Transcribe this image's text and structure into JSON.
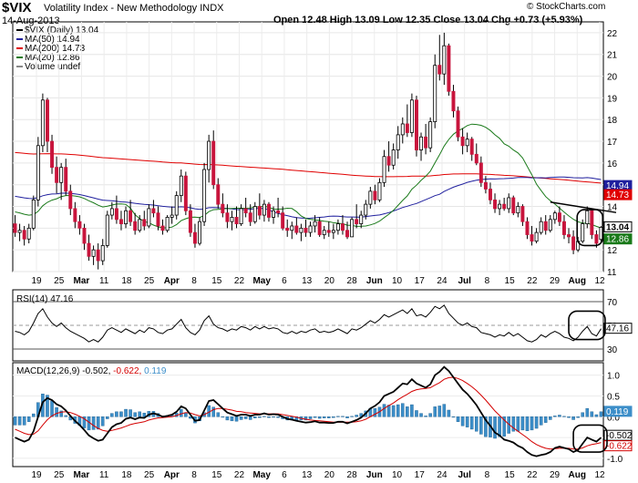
{
  "header": {
    "symbol": "$VIX",
    "name": "Volatility Index - New Methodology",
    "exchange": "INDX",
    "date": "14-Aug-2013",
    "ohlc_text": "Open 12.48  High 13.09  Low 12.35  Close 13.04  Chg +0.73 (+5.93%)",
    "open": "12.48",
    "high": "13.09",
    "low": "12.35",
    "close": "13.04",
    "change": "+0.73 (+5.93%)",
    "brand": "© StockCharts.com"
  },
  "legend": [
    {
      "label": "$VIX (Daily) 13.04",
      "color": "#000000"
    },
    {
      "label": "MA(50) 14.94",
      "color": "#1f1f9e"
    },
    {
      "label": "MA(200) 14.73",
      "color": "#e00000"
    },
    {
      "label": "MA(20) 12.86",
      "color": "#1a7a1a"
    },
    {
      "label": "Volume undef",
      "color": "#888888"
    }
  ],
  "rsi_label": "RSI(14) 47.16",
  "macd_label": {
    "prefix": "MACD(12,26,9)",
    "macd": "-0.502,",
    "signal": "-0.622,",
    "hist": "0.119",
    "macd_color": "#000000",
    "signal_color": "#d40000",
    "hist_color": "#3c8ec9"
  },
  "colors": {
    "up": "#ffffff",
    "down": "#c8143c",
    "ma50": "#1f1f9e",
    "ma200": "#e00000",
    "ma20": "#1a7a1a",
    "annotation": "#000000"
  },
  "chart_data": {
    "type": "candlestick",
    "price": {
      "ylim": [
        11,
        22.5
      ],
      "yticks": [
        11,
        12,
        13,
        14,
        15,
        16,
        17,
        18,
        19,
        20,
        21,
        22
      ],
      "right_labels": [
        "14.94",
        "14.73",
        "13.04",
        "12.86"
      ],
      "x_ticks": [
        "19",
        "25",
        "Mar",
        "11",
        "18",
        "25",
        "Apr",
        "8",
        "15",
        "22",
        "May",
        "6",
        "13",
        "20",
        "28",
        "Jun",
        "10",
        "17",
        "24",
        "Jul",
        "8",
        "15",
        "22",
        "29",
        "Aug",
        "12"
      ],
      "ohlc": [
        [
          13.2,
          13.6,
          12.6,
          12.8
        ],
        [
          12.8,
          13.2,
          12.4,
          12.9
        ],
        [
          12.9,
          13.1,
          12.2,
          12.5
        ],
        [
          12.5,
          13.2,
          12.3,
          13.0
        ],
        [
          13.0,
          14.5,
          12.9,
          14.3
        ],
        [
          14.3,
          17.2,
          14.0,
          16.8
        ],
        [
          16.8,
          19.2,
          16.5,
          18.9
        ],
        [
          18.9,
          19.0,
          16.5,
          17.0
        ],
        [
          17.0,
          17.3,
          15.5,
          15.8
        ],
        [
          15.8,
          16.3,
          14.6,
          15.1
        ],
        [
          15.1,
          16.0,
          14.3,
          15.8
        ],
        [
          15.8,
          16.2,
          14.5,
          14.7
        ],
        [
          14.7,
          15.0,
          13.6,
          13.9
        ],
        [
          13.9,
          14.2,
          13.0,
          13.3
        ],
        [
          13.3,
          13.6,
          12.7,
          13.0
        ],
        [
          13.0,
          13.2,
          12.0,
          12.3
        ],
        [
          12.3,
          12.7,
          11.5,
          11.7
        ],
        [
          11.7,
          12.2,
          11.3,
          12.0
        ],
        [
          12.0,
          12.3,
          11.1,
          11.5
        ],
        [
          11.5,
          12.5,
          11.3,
          12.2
        ],
        [
          12.2,
          13.8,
          12.1,
          13.6
        ],
        [
          13.6,
          14.2,
          13.4,
          13.9
        ],
        [
          13.9,
          14.5,
          13.2,
          13.4
        ],
        [
          13.4,
          13.8,
          12.9,
          13.2
        ],
        [
          13.2,
          14.0,
          13.0,
          13.8
        ],
        [
          13.8,
          14.3,
          13.1,
          13.3
        ],
        [
          13.3,
          13.7,
          12.7,
          12.9
        ],
        [
          12.9,
          13.6,
          12.8,
          13.4
        ],
        [
          13.4,
          13.8,
          12.9,
          13.1
        ],
        [
          13.1,
          14.1,
          13.0,
          13.9
        ],
        [
          13.9,
          14.3,
          13.5,
          13.7
        ],
        [
          13.7,
          14.0,
          12.9,
          13.1
        ],
        [
          13.1,
          13.4,
          12.7,
          12.9
        ],
        [
          12.9,
          13.6,
          12.8,
          13.5
        ],
        [
          13.5,
          14.0,
          13.2,
          13.6
        ],
        [
          13.6,
          14.7,
          13.4,
          14.5
        ],
        [
          14.5,
          15.7,
          14.2,
          15.4
        ],
        [
          15.4,
          15.6,
          13.6,
          13.8
        ],
        [
          13.8,
          14.1,
          12.6,
          12.8
        ],
        [
          12.8,
          13.2,
          12.1,
          12.3
        ],
        [
          12.3,
          13.5,
          12.2,
          13.3
        ],
        [
          13.3,
          16.0,
          13.1,
          15.7
        ],
        [
          15.7,
          17.3,
          15.1,
          17.0
        ],
        [
          17.0,
          17.5,
          14.8,
          15.0
        ],
        [
          15.0,
          15.3,
          13.9,
          14.1
        ],
        [
          14.1,
          14.6,
          13.5,
          13.7
        ],
        [
          13.7,
          14.1,
          13.0,
          13.3
        ],
        [
          13.3,
          13.8,
          12.9,
          13.5
        ],
        [
          13.5,
          14.0,
          13.0,
          13.2
        ],
        [
          13.2,
          14.1,
          13.1,
          13.9
        ],
        [
          13.9,
          14.4,
          13.5,
          13.7
        ],
        [
          13.7,
          14.1,
          13.1,
          13.3
        ],
        [
          13.3,
          14.2,
          13.2,
          14.0
        ],
        [
          14.0,
          14.6,
          13.4,
          13.6
        ],
        [
          13.6,
          14.3,
          13.3,
          14.1
        ],
        [
          14.1,
          14.2,
          13.3,
          13.5
        ],
        [
          13.5,
          14.0,
          13.2,
          13.8
        ],
        [
          13.8,
          14.4,
          13.5,
          13.7
        ],
        [
          13.7,
          14.0,
          12.9,
          13.0
        ],
        [
          13.0,
          13.4,
          12.6,
          12.9
        ],
        [
          12.9,
          13.3,
          12.5,
          13.1
        ],
        [
          13.1,
          13.5,
          12.7,
          12.8
        ],
        [
          12.8,
          13.2,
          12.4,
          13.0
        ],
        [
          13.0,
          13.4,
          12.6,
          12.8
        ],
        [
          12.8,
          13.3,
          12.6,
          13.1
        ],
        [
          13.1,
          13.6,
          12.8,
          13.3
        ],
        [
          13.3,
          13.5,
          12.6,
          12.7
        ],
        [
          12.7,
          13.1,
          12.5,
          12.9
        ],
        [
          12.9,
          13.3,
          12.6,
          12.8
        ],
        [
          12.8,
          13.2,
          12.5,
          12.9
        ],
        [
          12.9,
          13.4,
          12.7,
          13.2
        ],
        [
          13.2,
          13.6,
          12.7,
          12.9
        ],
        [
          12.9,
          13.3,
          12.5,
          12.6
        ],
        [
          12.6,
          13.5,
          12.6,
          13.4
        ],
        [
          13.4,
          14.1,
          13.0,
          13.2
        ],
        [
          13.2,
          13.8,
          13.0,
          13.6
        ],
        [
          13.6,
          14.3,
          13.4,
          14.1
        ],
        [
          14.1,
          14.9,
          13.9,
          14.7
        ],
        [
          14.7,
          15.0,
          14.1,
          14.3
        ],
        [
          14.3,
          15.3,
          14.2,
          15.1
        ],
        [
          15.1,
          16.6,
          14.9,
          16.3
        ],
        [
          16.3,
          17.0,
          15.6,
          15.9
        ],
        [
          15.9,
          16.9,
          15.7,
          16.6
        ],
        [
          16.6,
          17.7,
          16.2,
          17.3
        ],
        [
          17.3,
          18.1,
          16.9,
          17.8
        ],
        [
          17.8,
          18.7,
          17.2,
          17.4
        ],
        [
          17.4,
          19.2,
          17.2,
          18.9
        ],
        [
          18.9,
          19.1,
          16.3,
          16.6
        ],
        [
          16.6,
          17.4,
          16.1,
          17.2
        ],
        [
          17.2,
          17.8,
          16.4,
          16.7
        ],
        [
          16.7,
          18.1,
          16.5,
          17.9
        ],
        [
          17.9,
          21.0,
          17.6,
          20.5
        ],
        [
          20.5,
          21.9,
          19.8,
          20.1
        ],
        [
          20.1,
          22.0,
          19.6,
          21.4
        ],
        [
          21.4,
          21.5,
          19.1,
          19.3
        ],
        [
          19.3,
          19.6,
          18.1,
          18.4
        ],
        [
          18.4,
          18.6,
          17.0,
          17.2
        ],
        [
          17.2,
          17.6,
          16.4,
          16.8
        ],
        [
          16.8,
          17.4,
          16.5,
          17.1
        ],
        [
          17.1,
          17.2,
          16.1,
          16.4
        ],
        [
          16.4,
          16.9,
          15.9,
          16.0
        ],
        [
          16.0,
          16.3,
          14.9,
          15.1
        ],
        [
          15.1,
          15.4,
          14.6,
          14.8
        ],
        [
          14.8,
          15.1,
          14.1,
          14.3
        ],
        [
          14.3,
          14.6,
          13.7,
          13.9
        ],
        [
          13.9,
          14.3,
          13.6,
          14.1
        ],
        [
          14.1,
          14.4,
          13.8,
          13.9
        ],
        [
          13.9,
          14.6,
          13.7,
          14.4
        ],
        [
          14.4,
          14.5,
          13.6,
          13.7
        ],
        [
          13.7,
          14.2,
          13.5,
          14.0
        ],
        [
          14.0,
          14.1,
          13.1,
          13.3
        ],
        [
          13.3,
          13.5,
          12.5,
          12.7
        ],
        [
          12.7,
          13.1,
          12.2,
          12.4
        ],
        [
          12.4,
          13.0,
          12.3,
          12.8
        ],
        [
          12.8,
          13.5,
          12.7,
          13.3
        ],
        [
          13.3,
          13.6,
          12.7,
          12.9
        ],
        [
          12.9,
          13.6,
          12.8,
          13.4
        ],
        [
          13.4,
          13.8,
          13.2,
          13.7
        ],
        [
          13.7,
          14.0,
          13.1,
          13.3
        ],
        [
          13.3,
          13.6,
          12.5,
          12.7
        ],
        [
          12.7,
          13.0,
          12.3,
          12.6
        ],
        [
          12.6,
          12.9,
          11.8,
          12.0
        ],
        [
          12.0,
          12.6,
          11.9,
          12.4
        ],
        [
          12.4,
          13.4,
          12.3,
          13.2
        ],
        [
          13.2,
          14.0,
          13.0,
          13.8
        ],
        [
          13.8,
          13.9,
          12.5,
          12.7
        ],
        [
          12.7,
          12.9,
          12.1,
          12.3
        ],
        [
          12.48,
          13.09,
          12.35,
          13.04
        ]
      ]
    },
    "rsi": {
      "ylim": [
        20,
        80
      ],
      "levels": [
        30,
        50,
        70
      ],
      "tick_labels": [
        "70",
        "50",
        "30"
      ],
      "last_label": "47.16",
      "values": [
        45,
        44,
        42,
        45,
        52,
        60,
        64,
        57,
        52,
        49,
        52,
        48,
        45,
        43,
        41,
        39,
        36,
        38,
        36,
        40,
        46,
        48,
        46,
        44,
        47,
        45,
        43,
        46,
        44,
        48,
        47,
        44,
        43,
        46,
        47,
        51,
        55,
        48,
        44,
        42,
        46,
        54,
        58,
        51,
        48,
        47,
        45,
        47,
        46,
        49,
        48,
        46,
        49,
        47,
        49,
        47,
        48,
        47,
        44,
        43,
        45,
        43,
        45,
        44,
        46,
        47,
        44,
        45,
        44,
        45,
        47,
        45,
        43,
        47,
        46,
        48,
        51,
        54,
        52,
        55,
        59,
        57,
        59,
        61,
        63,
        60,
        64,
        58,
        59,
        57,
        61,
        66,
        64,
        67,
        60,
        56,
        52,
        50,
        52,
        49,
        48,
        44,
        43,
        42,
        40,
        42,
        41,
        44,
        41,
        43,
        40,
        37,
        36,
        38,
        42,
        40,
        43,
        45,
        43,
        40,
        39,
        37,
        40,
        45,
        49,
        43,
        41,
        47.16
      ]
    },
    "macd": {
      "ylim": [
        -1.2,
        1.3
      ],
      "tick_labels": [
        "1.0",
        "0.5",
        "0.0",
        "-0.5",
        "-1.0"
      ],
      "tick_values": [
        1.0,
        0.5,
        0.0,
        -0.5,
        -1.0
      ],
      "right_labels": [
        "0.119",
        "-0.502",
        "-0.622"
      ],
      "macd": [
        -0.5,
        -0.55,
        -0.6,
        -0.55,
        -0.35,
        0.0,
        0.35,
        0.45,
        0.4,
        0.3,
        0.25,
        0.15,
        0.02,
        -0.1,
        -0.2,
        -0.32,
        -0.45,
        -0.52,
        -0.58,
        -0.55,
        -0.4,
        -0.25,
        -0.18,
        -0.15,
        -0.05,
        -0.02,
        -0.06,
        -0.02,
        -0.03,
        0.05,
        0.08,
        0.05,
        0.0,
        0.02,
        0.05,
        0.12,
        0.25,
        0.2,
        0.05,
        -0.1,
        -0.08,
        0.15,
        0.38,
        0.4,
        0.3,
        0.2,
        0.1,
        0.06,
        0.02,
        0.05,
        0.05,
        0.02,
        0.05,
        0.05,
        0.08,
        0.05,
        0.06,
        0.05,
        0.0,
        -0.05,
        -0.07,
        -0.1,
        -0.12,
        -0.14,
        -0.13,
        -0.11,
        -0.14,
        -0.14,
        -0.15,
        -0.15,
        -0.12,
        -0.12,
        -0.16,
        -0.12,
        -0.08,
        -0.02,
        0.08,
        0.2,
        0.26,
        0.35,
        0.5,
        0.55,
        0.6,
        0.7,
        0.8,
        0.78,
        0.9,
        0.8,
        0.75,
        0.7,
        0.78,
        1.0,
        1.08,
        1.2,
        1.1,
        0.95,
        0.8,
        0.65,
        0.55,
        0.42,
        0.28,
        0.1,
        -0.08,
        -0.22,
        -0.38,
        -0.45,
        -0.55,
        -0.58,
        -0.62,
        -0.7,
        -0.75,
        -0.85,
        -0.92,
        -0.95,
        -0.92,
        -0.9,
        -0.85,
        -0.75,
        -0.72,
        -0.75,
        -0.78,
        -0.85,
        -0.8,
        -0.65,
        -0.5,
        -0.55,
        -0.6,
        -0.502
      ],
      "signal": [
        -0.3,
        -0.35,
        -0.4,
        -0.43,
        -0.42,
        -0.34,
        -0.2,
        -0.07,
        0.02,
        0.08,
        0.11,
        0.12,
        0.1,
        0.06,
        0.01,
        -0.05,
        -0.13,
        -0.21,
        -0.28,
        -0.33,
        -0.35,
        -0.33,
        -0.3,
        -0.27,
        -0.23,
        -0.19,
        -0.16,
        -0.14,
        -0.12,
        -0.08,
        -0.05,
        -0.03,
        -0.02,
        -0.01,
        0.0,
        0.03,
        0.07,
        0.1,
        0.09,
        0.05,
        0.02,
        0.05,
        0.11,
        0.17,
        0.2,
        0.2,
        0.18,
        0.16,
        0.13,
        0.12,
        0.1,
        0.09,
        0.08,
        0.07,
        0.07,
        0.07,
        0.07,
        0.07,
        0.05,
        0.03,
        0.01,
        -0.01,
        -0.04,
        -0.06,
        -0.08,
        -0.09,
        -0.1,
        -0.11,
        -0.12,
        -0.13,
        -0.13,
        -0.13,
        -0.13,
        -0.13,
        -0.12,
        -0.1,
        -0.06,
        0.0,
        0.06,
        0.12,
        0.2,
        0.27,
        0.33,
        0.41,
        0.48,
        0.54,
        0.61,
        0.65,
        0.67,
        0.68,
        0.7,
        0.76,
        0.82,
        0.9,
        0.94,
        0.95,
        0.92,
        0.87,
        0.8,
        0.72,
        0.63,
        0.52,
        0.4,
        0.27,
        0.14,
        0.03,
        -0.08,
        -0.18,
        -0.27,
        -0.35,
        -0.43,
        -0.51,
        -0.6,
        -0.67,
        -0.72,
        -0.76,
        -0.78,
        -0.77,
        -0.76,
        -0.76,
        -0.76,
        -0.78,
        -0.78,
        -0.75,
        -0.7,
        -0.67,
        -0.65,
        -0.622
      ]
    }
  }
}
